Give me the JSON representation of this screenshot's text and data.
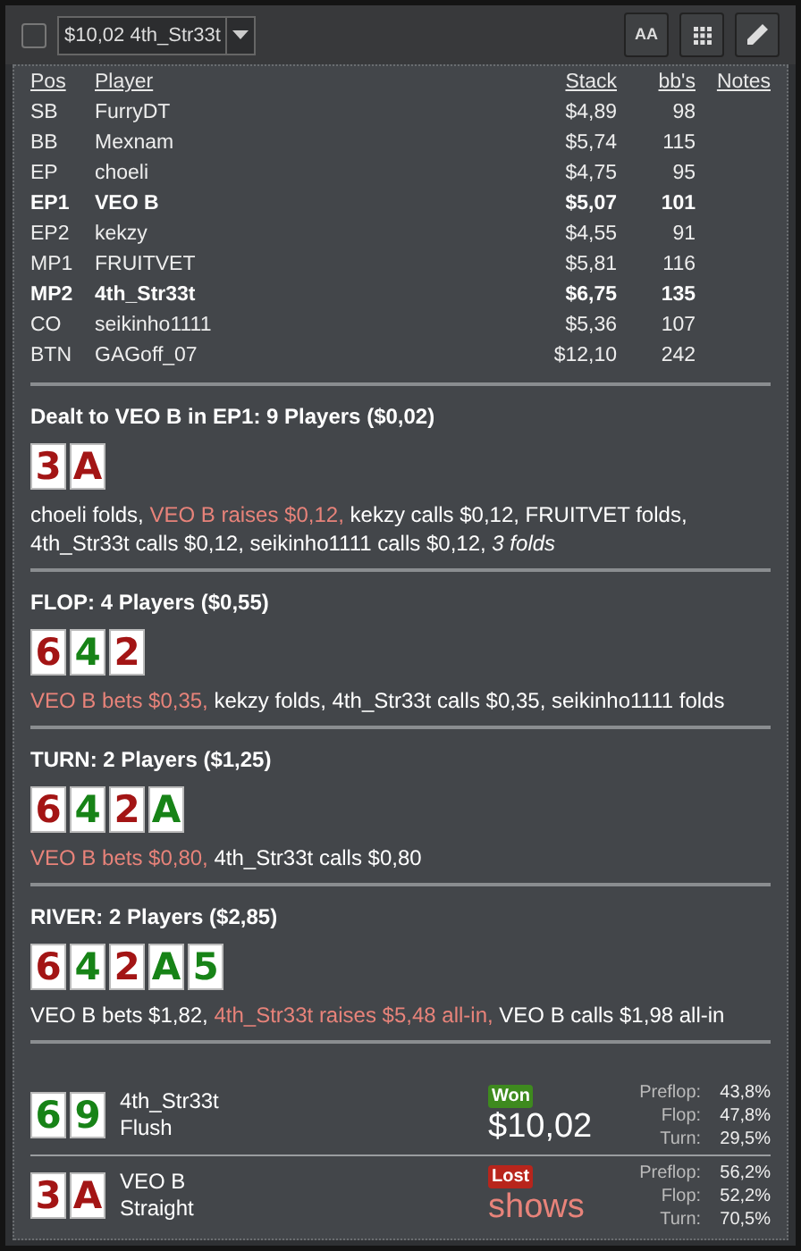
{
  "toolbar": {
    "checkbox_checked": false,
    "hand_select": "$10,02 4th_Str33t",
    "buttons": [
      {
        "kind": "font"
      },
      {
        "kind": "grid"
      },
      {
        "kind": "pencil"
      }
    ],
    "font_button_label": "AA"
  },
  "players_table": {
    "columns": [
      "Pos",
      "Player",
      "Stack",
      "bb's",
      "Notes"
    ],
    "rows": [
      {
        "pos": "SB",
        "player": "FurryDT",
        "stack": "$4,89",
        "bbs": "98",
        "emphasized": false
      },
      {
        "pos": "BB",
        "player": "Mexnam",
        "stack": "$5,74",
        "bbs": "115",
        "emphasized": false
      },
      {
        "pos": "EP",
        "player": "choeli",
        "stack": "$4,75",
        "bbs": "95",
        "emphasized": false
      },
      {
        "pos": "EP1",
        "player": "VEO B",
        "stack": "$5,07",
        "bbs": "101",
        "emphasized": true
      },
      {
        "pos": "EP2",
        "player": "kekzy",
        "stack": "$4,55",
        "bbs": "91",
        "emphasized": false
      },
      {
        "pos": "MP1",
        "player": "FRUITVET",
        "stack": "$5,81",
        "bbs": "116",
        "emphasized": false
      },
      {
        "pos": "MP2",
        "player": "4th_Str33t",
        "stack": "$6,75",
        "bbs": "135",
        "emphasized": true
      },
      {
        "pos": "CO",
        "player": "seikinho1111",
        "stack": "$5,36",
        "bbs": "107",
        "emphasized": false
      },
      {
        "pos": "BTN",
        "player": "GAGoff_07",
        "stack": "$12,10",
        "bbs": "242",
        "emphasized": false
      }
    ]
  },
  "streets": [
    {
      "title": "Dealt to VEO B in EP1: 9 Players ($0,02)",
      "cards": [
        {
          "rank": "3",
          "color": "#a31515"
        },
        {
          "rank": "A",
          "color": "#a31515"
        }
      ],
      "actions": [
        {
          "text": "choeli folds, ",
          "highlight": false,
          "italic": false
        },
        {
          "text": "VEO B raises $0,12, ",
          "highlight": true,
          "italic": false
        },
        {
          "text": "kekzy calls $0,12, FRUITVET folds, 4th_Str33t calls $0,12, seikinho1111 calls $0,12, ",
          "highlight": false,
          "italic": false
        },
        {
          "text": "3 folds",
          "highlight": false,
          "italic": true
        }
      ]
    },
    {
      "title": "FLOP: 4 Players ($0,55)",
      "cards": [
        {
          "rank": "6",
          "color": "#a31515"
        },
        {
          "rank": "4",
          "color": "#178317"
        },
        {
          "rank": "2",
          "color": "#a31515"
        }
      ],
      "actions": [
        {
          "text": "VEO B bets $0,35, ",
          "highlight": true,
          "italic": false
        },
        {
          "text": "kekzy folds, 4th_Str33t calls $0,35, seikinho1111 folds",
          "highlight": false,
          "italic": false
        }
      ]
    },
    {
      "title": "TURN: 2 Players ($1,25)",
      "cards": [
        {
          "rank": "6",
          "color": "#a31515"
        },
        {
          "rank": "4",
          "color": "#178317"
        },
        {
          "rank": "2",
          "color": "#a31515"
        },
        {
          "rank": "A",
          "color": "#178317"
        }
      ],
      "actions": [
        {
          "text": "VEO B bets $0,80, ",
          "highlight": true,
          "italic": false
        },
        {
          "text": "4th_Str33t calls $0,80",
          "highlight": false,
          "italic": false
        }
      ]
    },
    {
      "title": "RIVER: 2 Players ($2,85)",
      "cards": [
        {
          "rank": "6",
          "color": "#a31515"
        },
        {
          "rank": "4",
          "color": "#178317"
        },
        {
          "rank": "2",
          "color": "#a31515"
        },
        {
          "rank": "A",
          "color": "#178317"
        },
        {
          "rank": "5",
          "color": "#178317"
        }
      ],
      "actions": [
        {
          "text": "VEO B bets $1,82, ",
          "highlight": false,
          "italic": false
        },
        {
          "text": "4th_Str33t raises $5,48 all-in, ",
          "highlight": true,
          "italic": false
        },
        {
          "text": "VEO B calls $1,98 all-in",
          "highlight": false,
          "italic": false
        }
      ]
    }
  ],
  "results": [
    {
      "cards": [
        {
          "rank": "6",
          "color": "#178317"
        },
        {
          "rank": "9",
          "color": "#178317"
        }
      ],
      "player": "4th_Str33t",
      "hand": "Flush",
      "won": true,
      "badge": "Won",
      "amount": "$10,02",
      "equity": [
        {
          "label": "Preflop:",
          "value": "43,8%"
        },
        {
          "label": "Flop:",
          "value": "47,8%"
        },
        {
          "label": "Turn:",
          "value": "29,5%"
        }
      ]
    },
    {
      "cards": [
        {
          "rank": "3",
          "color": "#a31515"
        },
        {
          "rank": "A",
          "color": "#a31515"
        }
      ],
      "player": "VEO B",
      "hand": "Straight",
      "won": false,
      "badge": "Lost",
      "amount": "shows",
      "equity": [
        {
          "label": "Preflop:",
          "value": "56,2%"
        },
        {
          "label": "Flop:",
          "value": "52,2%"
        },
        {
          "label": "Turn:",
          "value": "70,5%"
        }
      ]
    }
  ]
}
